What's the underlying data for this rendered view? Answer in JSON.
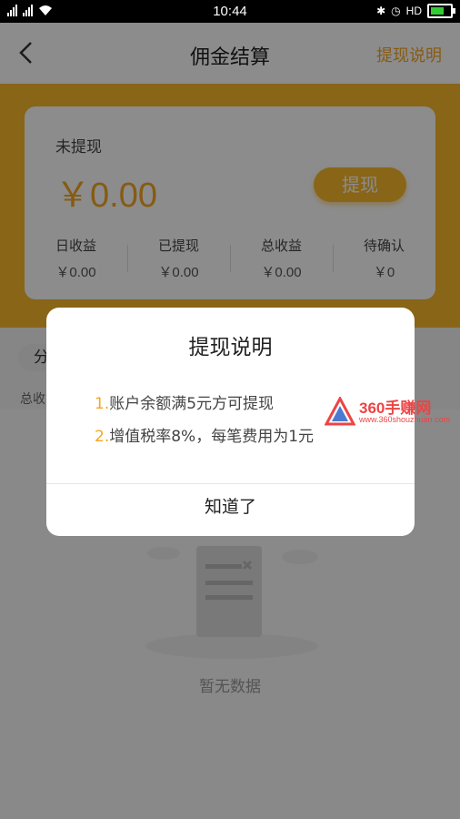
{
  "status_bar": {
    "time": "10:44",
    "network_left": "2G",
    "network_right": "4G",
    "hd_label": "HD"
  },
  "nav": {
    "title": "佣金结算",
    "right_link": "提现说明"
  },
  "card": {
    "label": "未提现",
    "amount": "￥0.00",
    "withdraw_button": "提现",
    "stats": [
      {
        "label": "日收益",
        "value": "￥0.00"
      },
      {
        "label": "已提现",
        "value": "￥0.00"
      },
      {
        "label": "总收益",
        "value": "￥0.00"
      },
      {
        "label": "待确认",
        "value": "￥0"
      }
    ]
  },
  "filter": {
    "pill": "分",
    "subline": "总收"
  },
  "empty": {
    "text": "暂无数据"
  },
  "dialog": {
    "title": "提现说明",
    "lines": [
      {
        "num": "1.",
        "text": "账户余额满5元方可提现"
      },
      {
        "num": "2.",
        "text": "增值税率8%，每笔费用为1元"
      }
    ],
    "ok_button": "知道了"
  },
  "watermark": {
    "text": "360手赚网",
    "url": "www.360shouzhuan.com"
  },
  "colors": {
    "accent": "#f7b82a",
    "accent_text": "#f5a623"
  }
}
